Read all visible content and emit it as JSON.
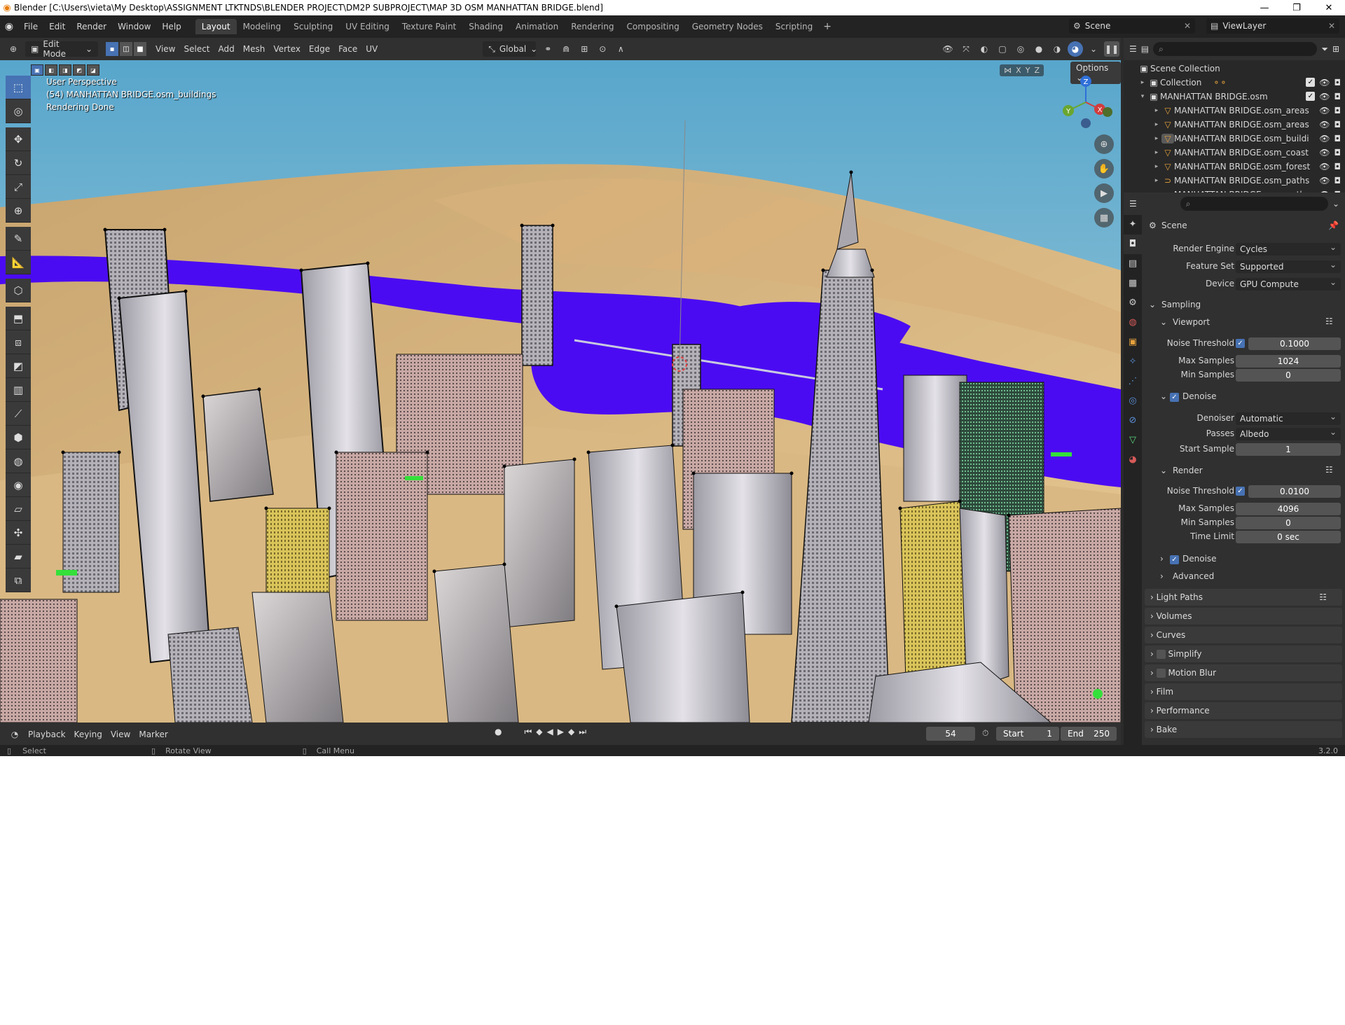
{
  "titlebar": {
    "title": "Blender [C:\\Users\\vieta\\My Desktop\\ASSIGNMENT LTKTNDS\\BLENDER PROJECT\\DM2P SUBPROJECT\\MAP 3D OSM MANHATTAN BRIDGE.blend]",
    "minimize": "—",
    "restore": "❐",
    "close": "✕"
  },
  "menus": [
    "File",
    "Edit",
    "Render",
    "Window",
    "Help"
  ],
  "workspaces": [
    "Layout",
    "Modeling",
    "Sculpting",
    "UV Editing",
    "Texture Paint",
    "Shading",
    "Animation",
    "Rendering",
    "Compositing",
    "Geometry Nodes",
    "Scripting"
  ],
  "workspace_plus": "+",
  "scene_name": "Scene",
  "view_layer": "ViewLayer",
  "viewport_header": {
    "mode": "Edit Mode",
    "menus": [
      "View",
      "Select",
      "Add",
      "Mesh",
      "Vertex",
      "Edge",
      "Face",
      "UV"
    ],
    "orientation": "Global",
    "options": "Options",
    "axes": [
      "X",
      "Y",
      "Z"
    ]
  },
  "viewport": {
    "perspective": "User Perspective",
    "object": "(54) MANHATTAN BRIDGE.osm_buildings",
    "status": "Rendering Done"
  },
  "gizmo": {
    "z": "Z",
    "y": "Y",
    "x": "X"
  },
  "timeline": {
    "menus": [
      "Playback",
      "Keying",
      "View",
      "Marker"
    ],
    "current_frame": "54",
    "start_label": "Start",
    "start": "1",
    "end_label": "End",
    "end": "250"
  },
  "statusbar": {
    "select": "Select",
    "rotate": "Rotate View",
    "menu": "Call Menu",
    "version": "3.2.0"
  },
  "outliner": {
    "root": "Scene Collection",
    "items": [
      {
        "name": "Collection",
        "level": 1
      },
      {
        "name": "MANHATTAN BRIDGE.osm",
        "level": 1
      },
      {
        "name": "MANHATTAN BRIDGE.osm_areas",
        "level": 2
      },
      {
        "name": "MANHATTAN BRIDGE.osm_areas",
        "level": 2
      },
      {
        "name": "MANHATTAN BRIDGE.osm_buildi",
        "level": 2
      },
      {
        "name": "MANHATTAN BRIDGE.osm_coast",
        "level": 2
      },
      {
        "name": "MANHATTAN BRIDGE.osm_forest",
        "level": 2
      },
      {
        "name": "MANHATTAN BRIDGE.osm_paths",
        "level": 2
      },
      {
        "name": "MANHATTAN BRIDGE.osm_paths",
        "level": 2
      }
    ]
  },
  "props": {
    "context": "Scene",
    "render_engine_label": "Render Engine",
    "render_engine": "Cycles",
    "feature_set_label": "Feature Set",
    "feature_set": "Supported",
    "device_label": "Device",
    "device": "GPU Compute",
    "sampling": "Sampling",
    "viewport": "Viewport",
    "vp_noise_label": "Noise Threshold",
    "vp_noise": "0.1000",
    "vp_max_label": "Max Samples",
    "vp_max": "1024",
    "vp_min_label": "Min Samples",
    "vp_min": "0",
    "denoise": "Denoise",
    "denoiser_label": "Denoiser",
    "denoiser": "Automatic",
    "passes_label": "Passes",
    "passes": "Albedo",
    "start_sample_label": "Start Sample",
    "start_sample": "1",
    "render": "Render",
    "r_noise_label": "Noise Threshold",
    "r_noise": "0.0100",
    "r_max_label": "Max Samples",
    "r_max": "4096",
    "r_min_label": "Min Samples",
    "r_min": "0",
    "time_limit_label": "Time Limit",
    "time_limit": "0 sec",
    "r_denoise": "Denoise",
    "advanced": "Advanced",
    "panels": [
      "Light Paths",
      "Volumes",
      "Curves",
      "Simplify",
      "Motion Blur",
      "Film",
      "Performance",
      "Bake"
    ]
  }
}
